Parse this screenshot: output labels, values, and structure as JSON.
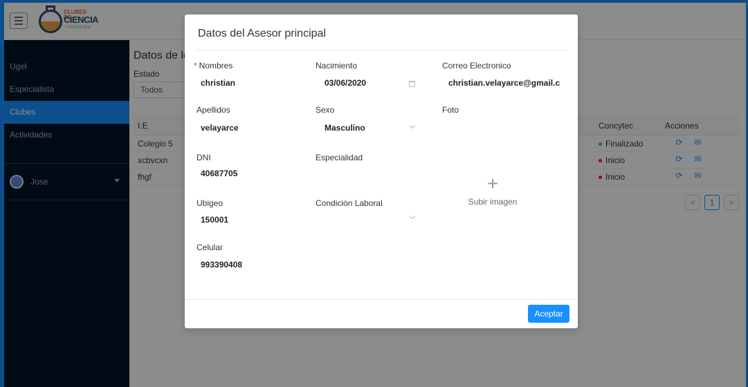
{
  "header": {
    "logo_line1": "CLUBES DE",
    "logo_line2": "CIENCIA",
    "logo_line3": "Y TECNOLOGIA"
  },
  "sidebar": {
    "items": [
      {
        "label": "Ugel"
      },
      {
        "label": "Especialista"
      },
      {
        "label": "Clubes"
      },
      {
        "label": "Actividades"
      }
    ],
    "user": "Jose"
  },
  "main": {
    "title": "Datos de lo",
    "estado_label": "Estado",
    "estado_value": "Todos",
    "columns": {
      "ie": "I.E",
      "concytec": "Concytec",
      "acciones": "Acciones"
    },
    "rows": [
      {
        "ie": "Colegio 5",
        "status": "Finalizado",
        "dot_color": "#52c41a"
      },
      {
        "ie": "xcbvcxn",
        "status": "Inicio",
        "dot_color": "#f5222d"
      },
      {
        "ie": "fhgf",
        "status": "Inicio",
        "dot_color": "#f5222d"
      }
    ],
    "pagination": {
      "prev": "<",
      "current": "1",
      "next": ">"
    }
  },
  "modal": {
    "title": "Datos del Asesor principal",
    "fields": {
      "nombres": {
        "label": "Nombres",
        "value": "christian"
      },
      "nacimiento": {
        "label": "Nacimiento",
        "value": "03/06/2020"
      },
      "correo": {
        "label": "Correo Electronico",
        "value": "christian.velayarce@gmail.c"
      },
      "apellidos": {
        "label": "Apellidos",
        "value": "velayarce"
      },
      "sexo": {
        "label": "Sexo",
        "value": "Masculino"
      },
      "foto": {
        "label": "Foto"
      },
      "dni": {
        "label": "DNI",
        "value": "40687705"
      },
      "especialidad": {
        "label": "Especialidad",
        "value": ""
      },
      "ubigeo": {
        "label": "Ubigeo",
        "value": "150001"
      },
      "condicion": {
        "label": "Condición Laboral",
        "value": ""
      },
      "celular": {
        "label": "Celular",
        "value": "993390408"
      }
    },
    "required_mark": "*",
    "upload_plus": "+",
    "upload_label": "Subir imagen",
    "ok_label": "Aceptar"
  },
  "colors": {
    "primary": "#1890ff",
    "sidebar": "#001529",
    "danger": "#f5222d",
    "success": "#52c41a"
  }
}
